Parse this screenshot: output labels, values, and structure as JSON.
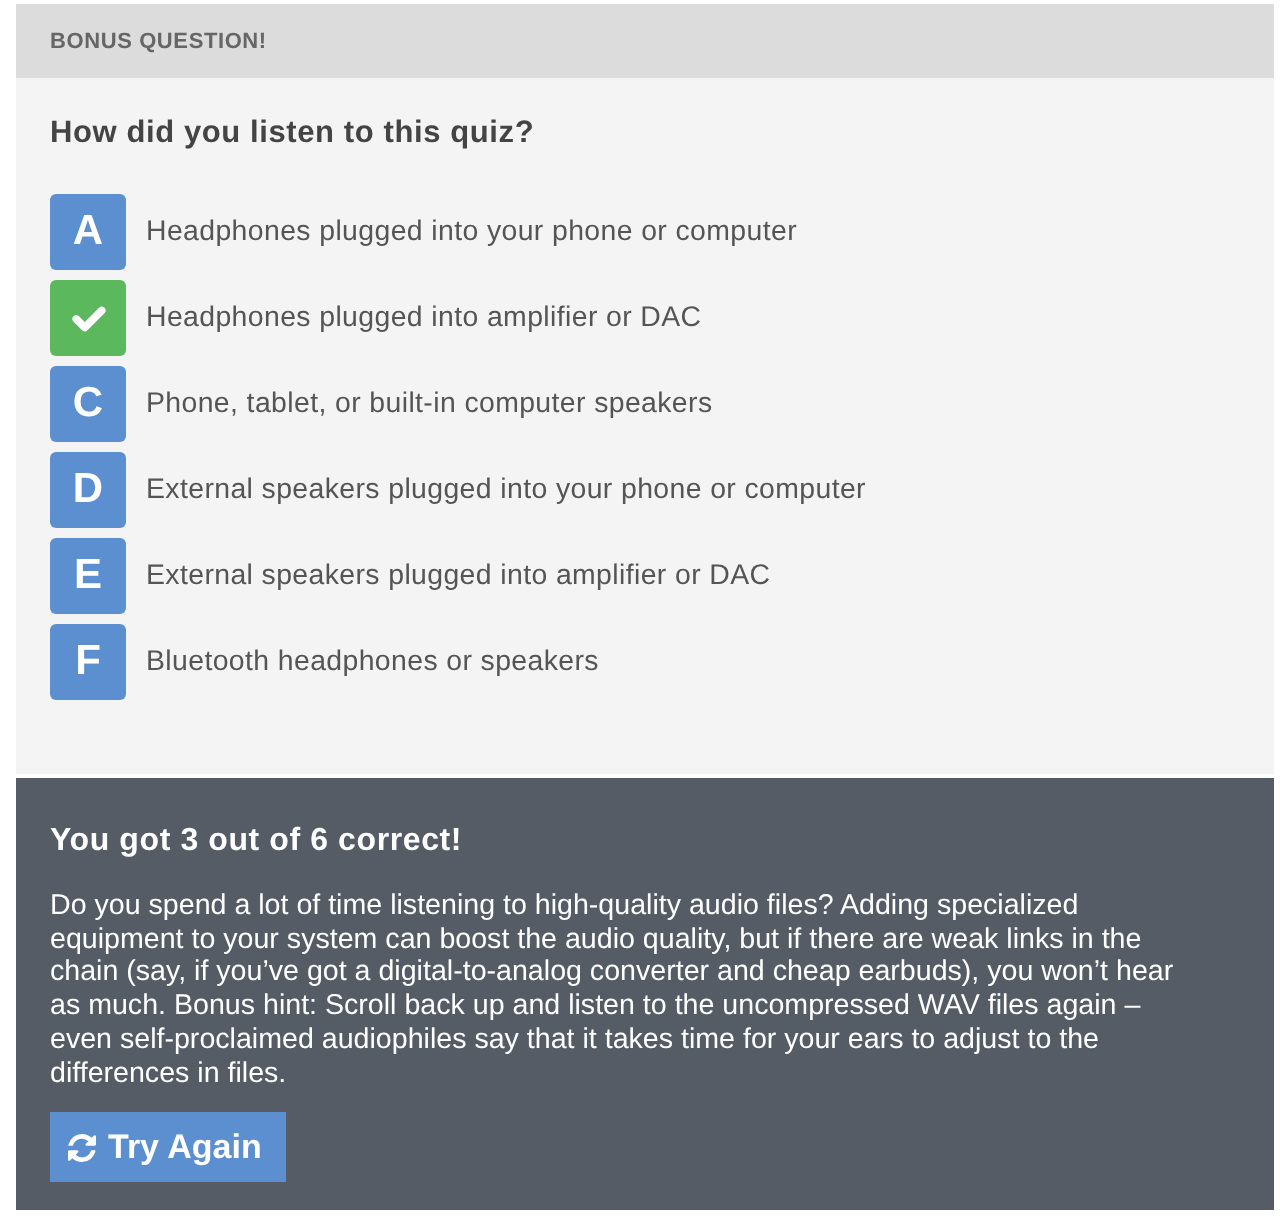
{
  "header": {
    "title": "BONUS QUESTION!"
  },
  "question": {
    "text": "How did you listen to this quiz?",
    "options": [
      {
        "letter": "A",
        "label": "Headphones plugged into your phone or computer",
        "selected": false
      },
      {
        "label": "Headphones plugged into amplifier or DAC",
        "selected": true
      },
      {
        "letter": "C",
        "label": "Phone, tablet, or built-in computer speakers",
        "selected": false
      },
      {
        "letter": "D",
        "label": "External speakers plugged into your phone or computer",
        "selected": false
      },
      {
        "letter": "E",
        "label": "External speakers plugged into amplifier or DAC",
        "selected": false
      },
      {
        "letter": "F",
        "label": "Bluetooth headphones or speakers",
        "selected": false
      }
    ]
  },
  "result": {
    "title": "You got 3 out of 6 correct!",
    "text": "Do you spend a lot of time listening to high-quality audio files? Adding specialized equipment to your system can boost the audio quality, but if there are weak links in the chain (say, if you’ve got a digital-to-analog converter and cheap earbuds), you won’t hear as much. Bonus hint: Scroll back up and listen to the uncompressed WAV files again – even self-proclaimed audiophiles say that it takes time for your ears to adjust to the differences in files.",
    "button": {
      "label": "Try Again"
    }
  }
}
